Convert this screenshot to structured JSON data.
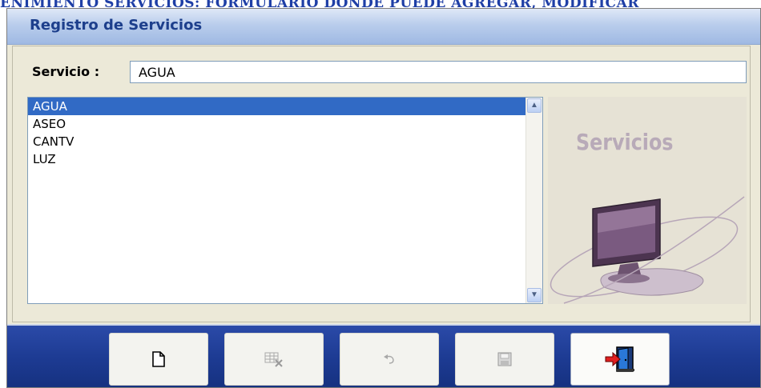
{
  "document": {
    "caption": "ENIMIENTO SERVICIOS: FORMULARIO DONDE PUEDE AGREGAR, MODIFICAR"
  },
  "window": {
    "title": "Registro de Servicios"
  },
  "form": {
    "servicio_label": "Servicio :",
    "servicio_value": "AGUA"
  },
  "list": {
    "items": [
      "AGUA",
      "ASEO",
      "CANTV",
      "LUZ"
    ],
    "selected_index": 0
  },
  "logo": {
    "text": "Servicios",
    "icon": "monitor-icon"
  },
  "toolbar": {
    "buttons": [
      {
        "name": "new-button",
        "icon": "new-document-icon",
        "enabled": true
      },
      {
        "name": "delete-button",
        "icon": "delete-record-icon",
        "enabled": false
      },
      {
        "name": "undo-button",
        "icon": "undo-icon",
        "enabled": false
      },
      {
        "name": "save-button",
        "icon": "save-disk-icon",
        "enabled": false
      },
      {
        "name": "exit-button",
        "icon": "exit-door-icon",
        "enabled": true
      }
    ]
  },
  "colors": {
    "selection": "#316ac5",
    "toolbar_blue": "#1d3b93",
    "title_text": "#1d3f8c",
    "logo_text": "#b8aab8"
  }
}
